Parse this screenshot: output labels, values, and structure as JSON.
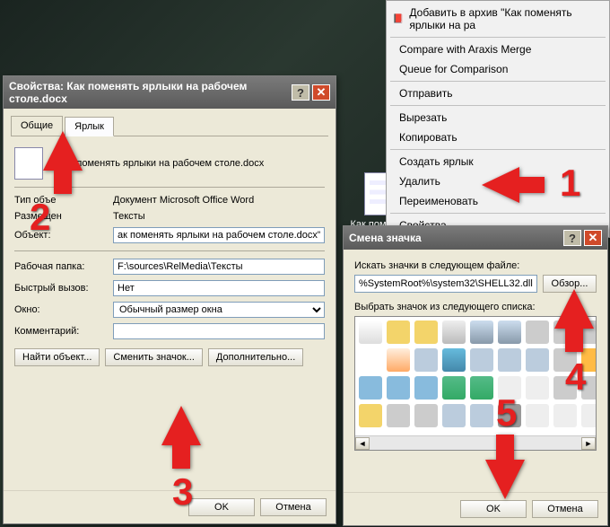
{
  "context_menu": {
    "add_to_archive": "Добавить в архив \"Как поменять ярлыки на ра",
    "compare": "Compare with Araxis Merge",
    "queue": "Queue for Comparison",
    "send": "Отправить",
    "cut": "Вырезать",
    "copy": "Копировать",
    "create_shortcut": "Создать ярлык",
    "delete": "Удалить",
    "rename": "Переименовать",
    "properties": "Свойства"
  },
  "desktop": {
    "icon_label": "Как поменять"
  },
  "props_dialog": {
    "title": "Свойства: Как поменять ярлыки на рабочем столе.docx",
    "tabs": {
      "general": "Общие",
      "shortcut": "Ярлык"
    },
    "filename": "Как поменять ярлыки на рабочем столе.docx",
    "type_label": "Тип объе",
    "type_value": "Документ Microsoft Office Word",
    "location_label": "Размещен",
    "location_value": "Тексты",
    "target_label": "Объект:",
    "target_value": "ак поменять ярлыки на рабочем столе.docx\"",
    "workdir_label": "Рабочая папка:",
    "workdir_value": "F:\\sources\\RelMedia\\Тексты",
    "hotkey_label": "Быстрый вызов:",
    "hotkey_value": "Нет",
    "run_label": "Окно:",
    "run_value": "Обычный размер окна",
    "comment_label": "Комментарий:",
    "comment_value": "",
    "btn_find": "Найти объект...",
    "btn_change_icon": "Сменить значок...",
    "btn_advanced": "Дополнительно...",
    "btn_ok": "OK",
    "btn_cancel": "Отмена"
  },
  "icon_dialog": {
    "title": "Смена значка",
    "search_label": "Искать значки в следующем файле:",
    "path_value": "%SystemRoot%\\system32\\SHELL32.dll",
    "btn_browse": "Обзор...",
    "pick_label": "Выбрать значок из следующего списка:",
    "btn_ok": "OK",
    "btn_cancel": "Отмена"
  },
  "markers": {
    "n1": "1",
    "n2": "2",
    "n3": "3",
    "n4": "4",
    "n5": "5"
  }
}
